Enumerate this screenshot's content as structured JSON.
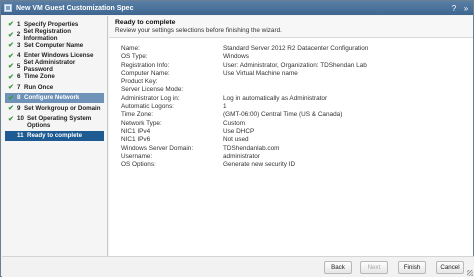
{
  "window": {
    "title": "New VM Guest Customization Spec"
  },
  "titlebar_buttons": {
    "help": "?",
    "expand": "»"
  },
  "steps": [
    {
      "num": "1",
      "label": "Specify Properties",
      "done": "✔"
    },
    {
      "num": "2",
      "label": "Set Registration Information",
      "done": "✔"
    },
    {
      "num": "3",
      "label": "Set Computer Name",
      "done": "✔"
    },
    {
      "num": "4",
      "label": "Enter Windows License",
      "done": "✔"
    },
    {
      "num": "5",
      "label": "Set Administrator Password",
      "done": "✔"
    },
    {
      "num": "6",
      "label": "Time Zone",
      "done": "✔"
    },
    {
      "num": "7",
      "label": "Run Once",
      "done": "✔"
    },
    {
      "num": "8",
      "label": "Configure Network",
      "done": "✔"
    },
    {
      "num": "9",
      "label": "Set Workgroup or Domain",
      "done": "✔"
    },
    {
      "num": "10",
      "label": "Set Operating System Options",
      "done": "✔"
    },
    {
      "num": "11",
      "label": "Ready to complete",
      "done": ""
    }
  ],
  "header": {
    "title": "Ready to complete",
    "subtitle": "Review your settings selections before finishing the wizard."
  },
  "summary": [
    {
      "label": "Name:",
      "value": "Standard Server 2012 R2 Datacenter Configuration"
    },
    {
      "label": "OS Type:",
      "value": "Windows"
    },
    {
      "label": "Registration Info:",
      "value": "User: Administrator, Organization: TDShendan Lab"
    },
    {
      "label": "Computer Name:",
      "value": "Use Virtual Machine name"
    },
    {
      "label": "Product Key:",
      "value": ""
    },
    {
      "label": "Server License Mode:",
      "value": ""
    },
    {
      "label": "Administrator Log in:",
      "value": "Log in automatically as Administrator"
    },
    {
      "label": "Automatic Logons:",
      "value": "1"
    },
    {
      "label": "Time Zone:",
      "value": "(GMT-06:00) Central Time (US & Canada)"
    },
    {
      "label": "Network Type:",
      "value": "Custom"
    },
    {
      "label": "NIC1 IPv4",
      "value": "Use DHCP"
    },
    {
      "label": "NIC1 IPv6",
      "value": "Not used"
    },
    {
      "label": "Windows Server Domain:",
      "value": "TDShendanlab.com"
    },
    {
      "label": "Username:",
      "value": "administrator"
    },
    {
      "label": "OS Options:",
      "value": "Generate new security ID"
    }
  ],
  "footer": {
    "back": "Back",
    "next": "Next",
    "finish": "Finish",
    "cancel": "Cancel"
  }
}
